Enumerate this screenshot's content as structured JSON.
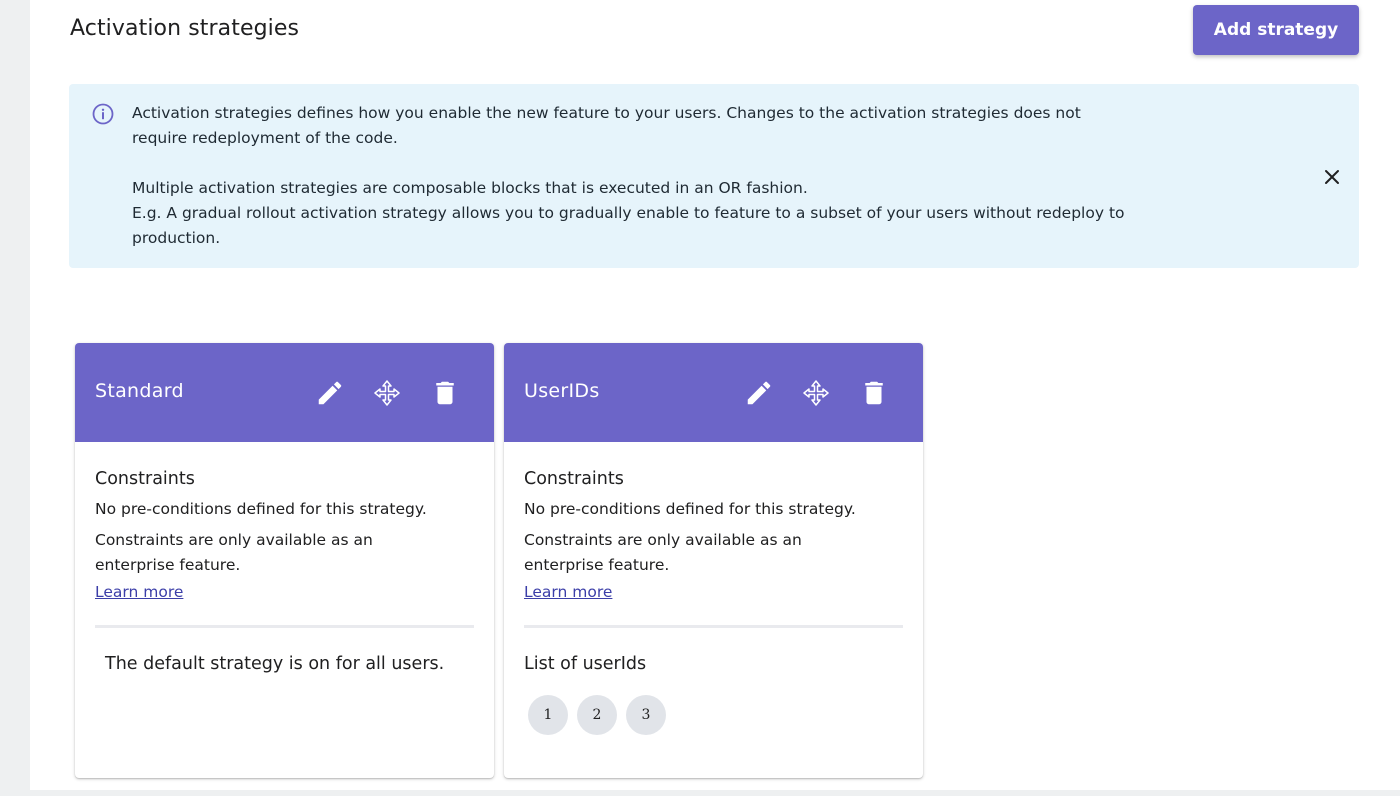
{
  "header": {
    "title": "Activation strategies",
    "add_button_label": "Add strategy"
  },
  "info_alert": {
    "paragraph_1": "Activation strategies defines how you enable the new feature to your users. Changes to the activation strategies does not require redeployment of the code.",
    "paragraph_2_line_1": "Multiple activation strategies are composable blocks that is executed in an OR fashion.",
    "paragraph_2_line_2": "E.g. A gradual rollout activation strategy allows you to gradually enable to feature to a subset of your users without redeploy to production."
  },
  "cards": [
    {
      "title": "Standard",
      "constraints_heading": "Constraints",
      "no_preconditions": "No pre-conditions defined for this strategy.",
      "enterprise_note": "Constraints are only available as an enterprise feature.",
      "learn_more": "Learn more",
      "description": "The default strategy is on for all users."
    },
    {
      "title": "UserIDs",
      "constraints_heading": "Constraints",
      "no_preconditions": "No pre-conditions defined for this strategy.",
      "enterprise_note": "Constraints are only available as an enterprise feature.",
      "learn_more": "Learn more",
      "list_heading": "List of userIds",
      "user_ids": [
        "1",
        "2",
        "3"
      ]
    }
  ],
  "colors": {
    "primary": "#6c65c8",
    "alert_background": "#e6f4fb",
    "link": "#3b3ea8",
    "chip_background": "#e1e4e9"
  },
  "icons": {
    "info": "info-icon",
    "close": "close-icon",
    "edit": "pencil-icon",
    "move": "drag-move-icon",
    "delete": "trash-icon"
  }
}
